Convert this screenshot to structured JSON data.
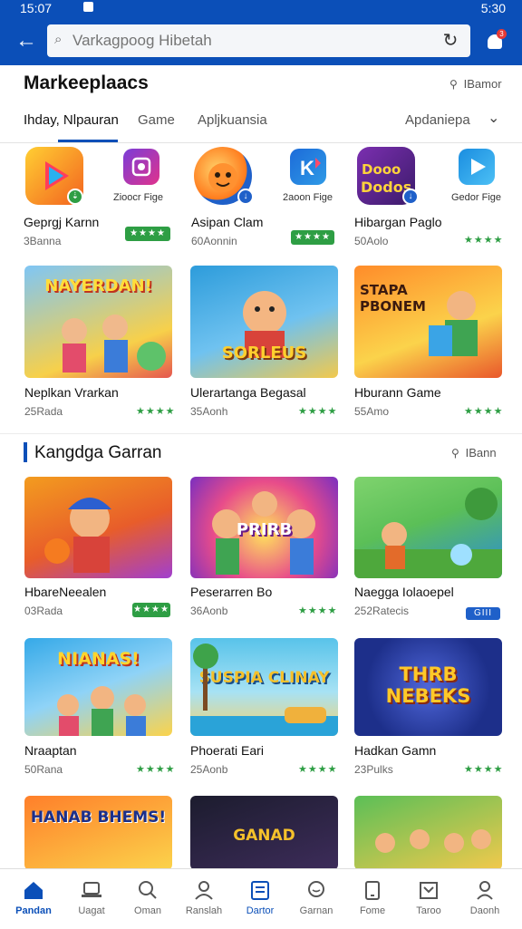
{
  "status": {
    "time": "15:07",
    "right": "5:30"
  },
  "search": {
    "placeholder": "Varkagpoog Hibetah"
  },
  "page": {
    "title": "Markeeplaacs",
    "top_link": "IBamor"
  },
  "tabs": [
    {
      "label": "Ihday, Nlpauran",
      "active": true
    },
    {
      "label": "Game",
      "active": false
    },
    {
      "label": "Apljkuansia",
      "active": false
    },
    {
      "label": "Apdaniepa",
      "active": false
    }
  ],
  "top_apps": [
    {
      "name": "Geprgj Karnn",
      "meta": "3Banna",
      "rating": "★★★★",
      "icon": "play-icon",
      "color": "#f39c1f"
    },
    {
      "name": "Asipan Clam",
      "meta": "60Aonnin",
      "rating": "★★★★",
      "icon": "sun-icon",
      "color": "#ff7a1c"
    },
    {
      "name": "Hibargan Paglo",
      "meta": "50Aolo",
      "rating": "★★★★",
      "icon": "dodos-icon",
      "color": "#5b2a8c"
    }
  ],
  "mini_apps": [
    {
      "label": "Zioocr Fige",
      "icon": "camera-icon",
      "color": "#c1349a"
    },
    {
      "label": "2aoon Fige",
      "icon": "k-icon",
      "color": "#1c6bd9"
    },
    {
      "label": "Gedor Fige",
      "icon": "play-icon",
      "color": "#1a8de0"
    }
  ],
  "banners_row1": [
    {
      "name": "Neplkan Vrarkan",
      "meta": "25Rada",
      "rating": "★★★★",
      "art": "NAYERDAN!",
      "colors": [
        "#6ab7f0",
        "#f5d04a"
      ]
    },
    {
      "name": "Ulerartanga Begasal",
      "meta": "35Aonh",
      "rating": "★★★★",
      "art": "SORLEUS",
      "colors": [
        "#2d9cdb",
        "#f2c94c"
      ]
    },
    {
      "name": "Hburann Game",
      "meta": "55Amo",
      "rating": "★★★★",
      "art": "STAPA PBONEM",
      "colors": [
        "#ff8c2a",
        "#fbd34b"
      ]
    }
  ],
  "section": {
    "title": "Kangdga Garran",
    "link": "IBann"
  },
  "banners_row2": [
    {
      "name": "HbareNeealen",
      "meta": "03Rada",
      "rating": "★★★★",
      "pill": true,
      "art": "",
      "colors": [
        "#f39c1f",
        "#a13fcf"
      ]
    },
    {
      "name": "Peserarren Bo",
      "meta": "36Aonb",
      "rating": "★★★★",
      "pill": false,
      "art": "PRIRB",
      "colors": [
        "#e84c8a",
        "#fbd34b"
      ]
    },
    {
      "name": "Naegga Iolaoepel",
      "meta": "252Ratecis",
      "rating": "GIII",
      "pill": false,
      "art": "",
      "colors": [
        "#5bbf57",
        "#2a8bd9"
      ]
    }
  ],
  "banners_row3": [
    {
      "name": "Nraaptan",
      "meta": "50Rana",
      "rating": "★★★★",
      "art": "NIANAS!",
      "colors": [
        "#35a9e8",
        "#fbd34b"
      ]
    },
    {
      "name": "Phoerati Eari",
      "meta": "25Aonb",
      "rating": "★★★★",
      "art": "SUSPIA CLINAY",
      "colors": [
        "#58c3ea",
        "#f7d26a"
      ]
    },
    {
      "name": "Hadkan Gamn",
      "meta": "23Pulks",
      "rating": "★★★★",
      "art": "THRB NEBEKS",
      "colors": [
        "#1d2f8a",
        "#4f66d9"
      ]
    }
  ],
  "banners_row4": [
    {
      "art": "HANAB BHEMS!",
      "colors": [
        "#ff7f2a",
        "#fbd34b"
      ]
    },
    {
      "art": "GANAD",
      "colors": [
        "#1c1c2e",
        "#3d2c5a"
      ]
    },
    {
      "art": "",
      "colors": [
        "#5bbf57",
        "#f2c94c"
      ]
    }
  ],
  "bottom_nav": [
    {
      "label": "Pandan",
      "icon": "home-icon",
      "active": true
    },
    {
      "label": "Uagat",
      "icon": "laptop-icon",
      "active": false
    },
    {
      "label": "Oman",
      "icon": "search-icon",
      "active": false
    },
    {
      "label": "Ranslah",
      "icon": "user-icon",
      "active": false
    },
    {
      "label": "Dartor",
      "icon": "list-icon",
      "active": false
    },
    {
      "label": "Garnan",
      "icon": "chat-icon",
      "active": false
    },
    {
      "label": "Fome",
      "icon": "device-icon",
      "active": false
    },
    {
      "label": "Taroo",
      "icon": "store-icon",
      "active": false
    },
    {
      "label": "Daonh",
      "icon": "profile-icon",
      "active": false
    }
  ]
}
